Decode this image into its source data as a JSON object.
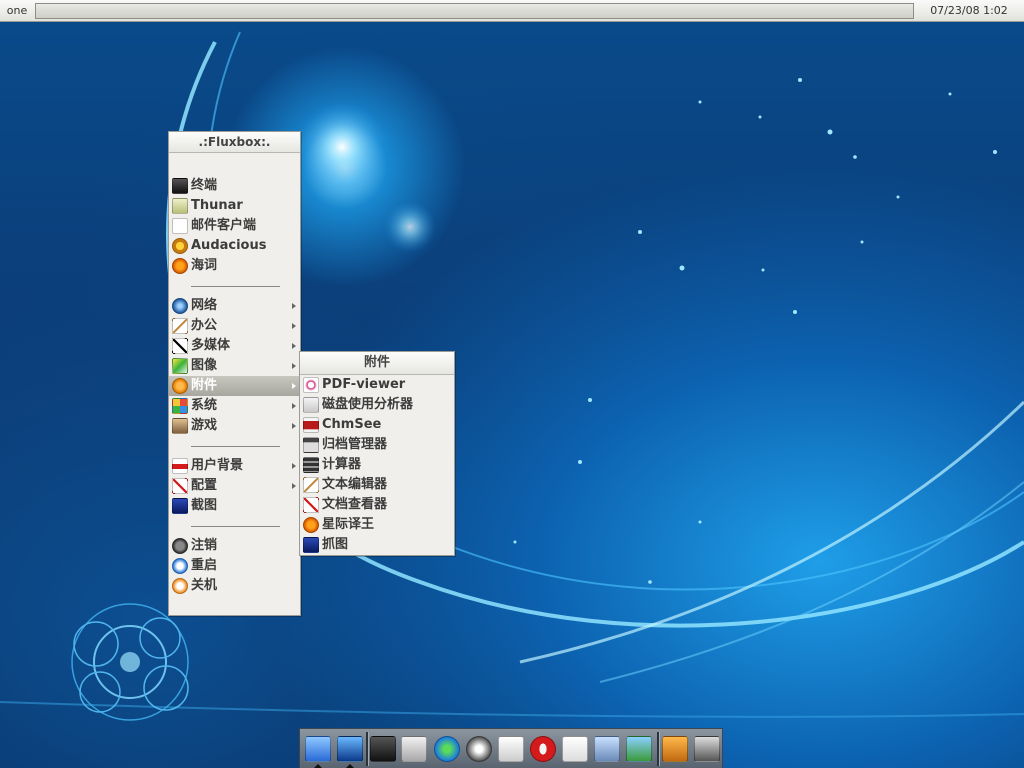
{
  "topbar": {
    "workspace": "one",
    "clock": "07/23/08  1:02"
  },
  "root_menu": {
    "title": ".:Fluxbox:.",
    "groups": [
      [
        {
          "label": "终端",
          "icon": "terminal-icon",
          "submenu": false
        },
        {
          "label": "Thunar",
          "icon": "folder-icon",
          "submenu": false
        },
        {
          "label": "邮件客户端",
          "icon": "mail-icon",
          "submenu": false
        },
        {
          "label": "Audacious",
          "icon": "audio-player-icon",
          "submenu": false
        },
        {
          "label": "海词",
          "icon": "dictionary-icon",
          "submenu": false
        }
      ],
      [
        {
          "label": "网络",
          "icon": "network-icon",
          "submenu": true
        },
        {
          "label": "办公",
          "icon": "office-icon",
          "submenu": true
        },
        {
          "label": "多媒体",
          "icon": "multimedia-icon",
          "submenu": true
        },
        {
          "label": "图像",
          "icon": "graphics-icon",
          "submenu": true
        },
        {
          "label": "附件",
          "icon": "accessories-icon",
          "submenu": true,
          "highlighted": true
        },
        {
          "label": "系统",
          "icon": "system-icon",
          "submenu": true
        },
        {
          "label": "游戏",
          "icon": "games-icon",
          "submenu": true
        }
      ],
      [
        {
          "label": "用户背景",
          "icon": "wallpaper-icon",
          "submenu": true
        },
        {
          "label": "配置",
          "icon": "config-icon",
          "submenu": true
        },
        {
          "label": "截图",
          "icon": "screenshot-icon",
          "submenu": false
        }
      ],
      [
        {
          "label": "注销",
          "icon": "logout-icon",
          "submenu": false
        },
        {
          "label": "重启",
          "icon": "restart-icon",
          "submenu": false
        },
        {
          "label": "关机",
          "icon": "shutdown-icon",
          "submenu": false
        }
      ]
    ]
  },
  "sub_menu": {
    "title": "附件",
    "items": [
      {
        "label": "PDF-viewer",
        "icon": "pdf-viewer-icon"
      },
      {
        "label": "磁盘使用分析器",
        "icon": "disk-analyzer-icon"
      },
      {
        "label": "ChmSee",
        "icon": "chm-viewer-icon"
      },
      {
        "label": "归档管理器",
        "icon": "archive-manager-icon"
      },
      {
        "label": "计算器",
        "icon": "calculator-icon"
      },
      {
        "label": "文本编辑器",
        "icon": "text-editor-icon"
      },
      {
        "label": "文档查看器",
        "icon": "document-viewer-icon"
      },
      {
        "label": "星际译王",
        "icon": "stardict-icon"
      },
      {
        "label": "抓图",
        "icon": "screenshot-tool-icon"
      }
    ]
  },
  "dock": {
    "items": [
      {
        "icon": "finder-icon",
        "running": true
      },
      {
        "icon": "desktop-icon",
        "running": true
      },
      {
        "icon": "terminal-icon",
        "running": false
      },
      {
        "icon": "file-manager-icon",
        "running": false
      },
      {
        "icon": "internet-icon",
        "running": false
      },
      {
        "icon": "network-browser-icon",
        "running": false
      },
      {
        "icon": "news-reader-icon",
        "running": false
      },
      {
        "icon": "opera-icon",
        "running": false
      },
      {
        "icon": "text-edit-icon",
        "running": false
      },
      {
        "icon": "mail-app-icon",
        "running": false
      },
      {
        "icon": "image-viewer-icon",
        "running": false
      },
      {
        "icon": "dictionary-app-icon",
        "running": false
      },
      {
        "icon": "settings-app-icon",
        "running": false
      }
    ]
  },
  "colors": {
    "menu_bg": "#f0efeb",
    "menu_highlight": "#b0afa7",
    "desktop_blue": "#0b4f94",
    "dock_bg": "#747e88"
  }
}
